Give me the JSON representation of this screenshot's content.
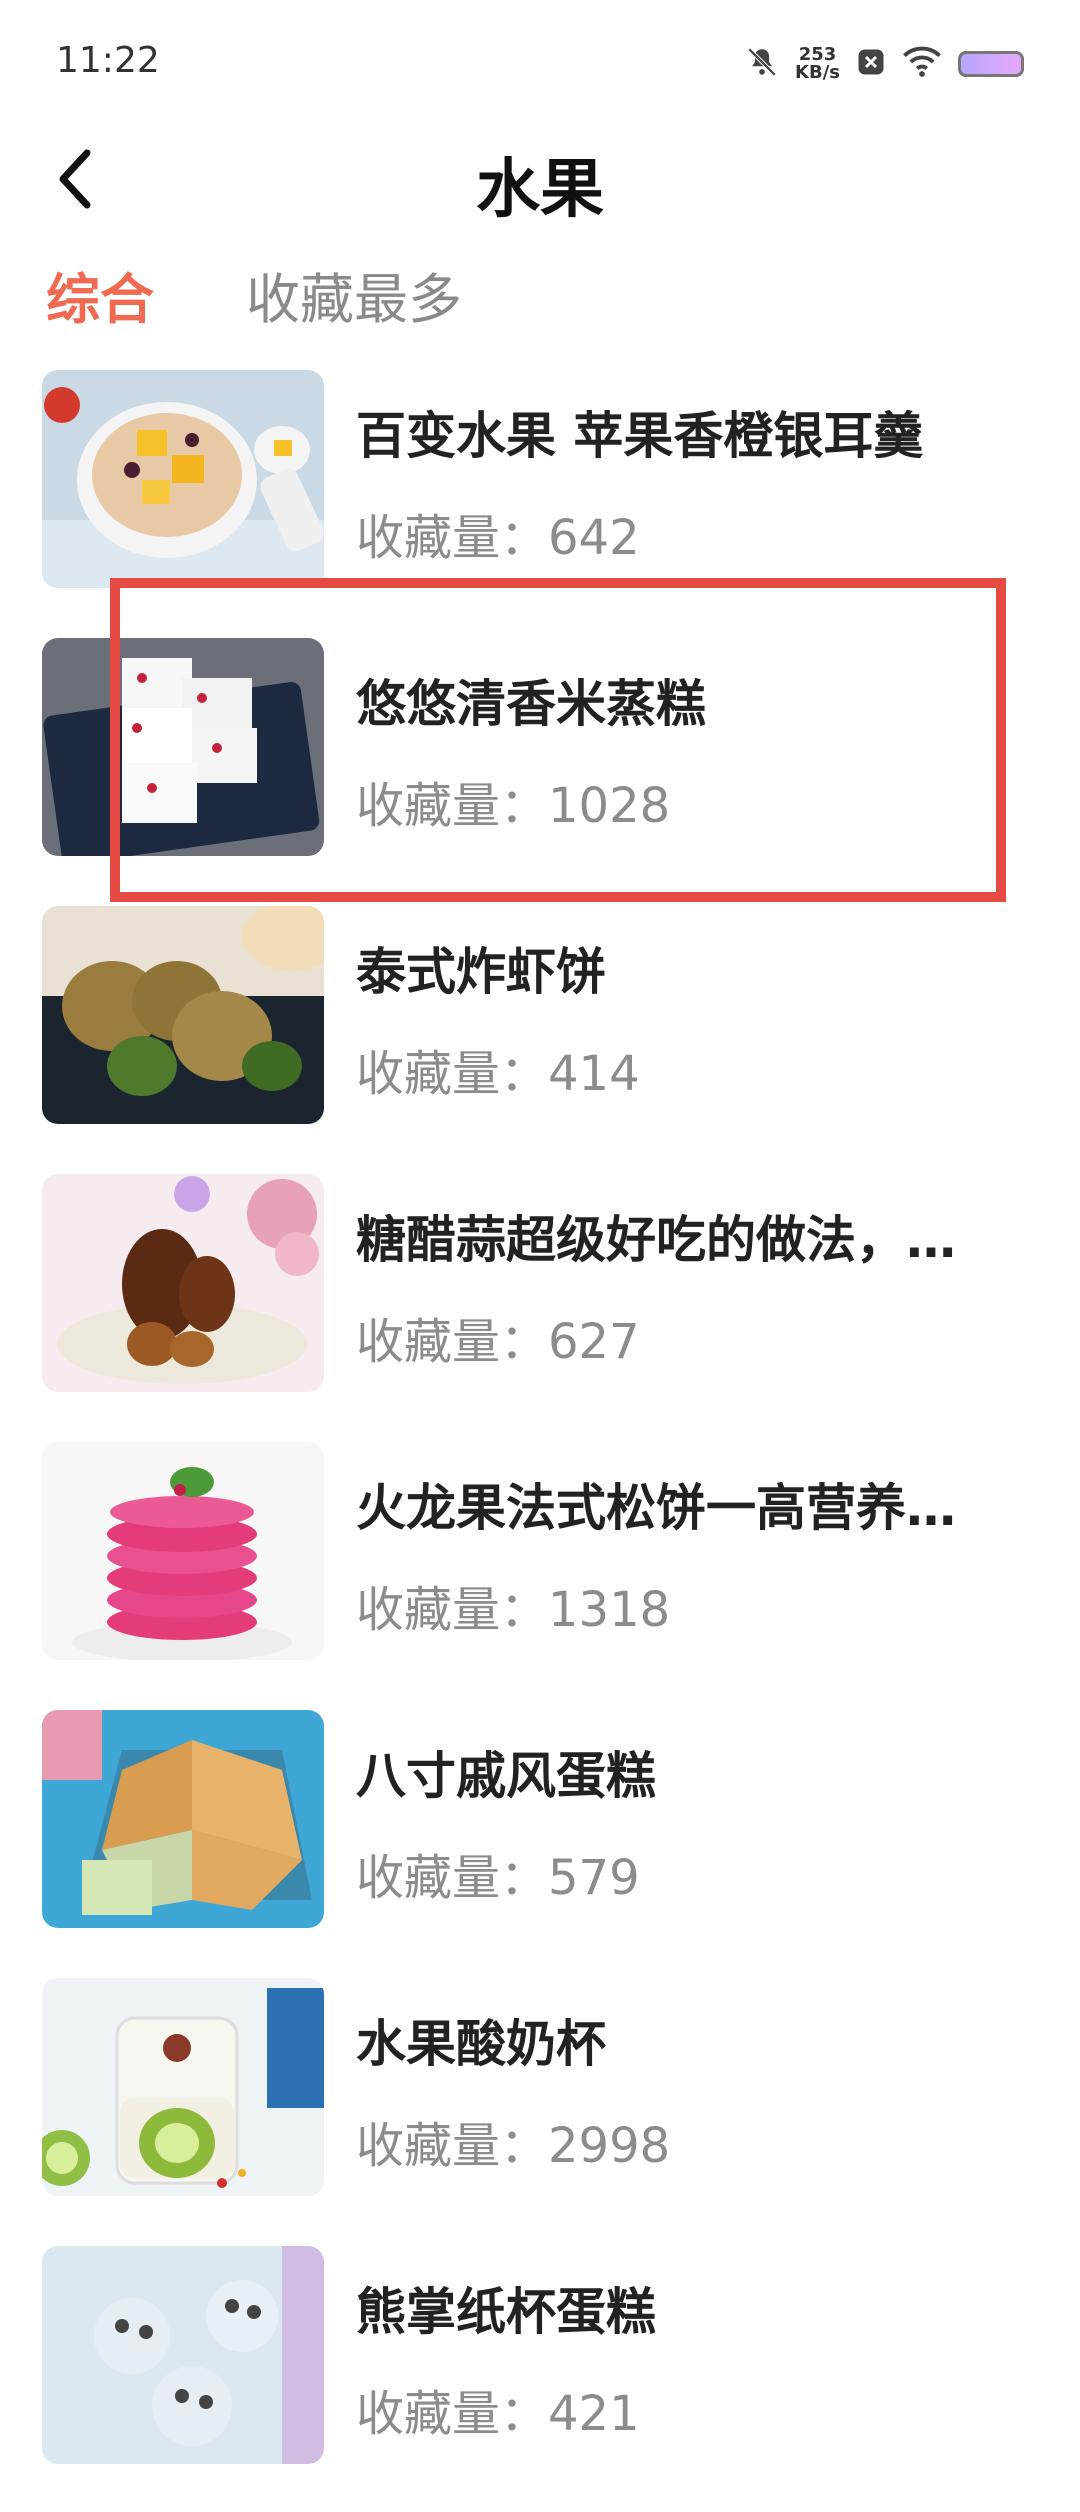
{
  "status_bar": {
    "time": "11:22",
    "net_speed_value": "253",
    "net_speed_unit": "KB/s",
    "icons": [
      "mute-bell-icon",
      "blocked-app-icon",
      "wifi-icon",
      "battery-icon"
    ]
  },
  "header": {
    "title": "水果",
    "back_icon": "chevron-left-icon"
  },
  "tabs": [
    {
      "label": "综合",
      "active": true
    },
    {
      "label": "收藏最多",
      "active": false
    }
  ],
  "fav_prefix": "收藏量：",
  "items": [
    {
      "title": "百变水果 苹果香橙银耳羹",
      "fav_count": "642"
    },
    {
      "title": "悠悠清香米蒸糕",
      "fav_count": "1028"
    },
    {
      "title": "泰式炸虾饼",
      "fav_count": "414"
    },
    {
      "title": "糖醋蒜超级好吃的做法，…",
      "fav_count": "627"
    },
    {
      "title": "火龙果法式松饼一高营养…",
      "fav_count": "1318"
    },
    {
      "title": "八寸戚风蛋糕",
      "fav_count": "579"
    },
    {
      "title": "水果酸奶杯",
      "fav_count": "2998"
    },
    {
      "title": "熊掌纸杯蛋糕",
      "fav_count": "421"
    }
  ],
  "colors": {
    "accent": "#f06a52",
    "highlight_box": "#e64a42",
    "muted_text": "#8c8c8c"
  }
}
